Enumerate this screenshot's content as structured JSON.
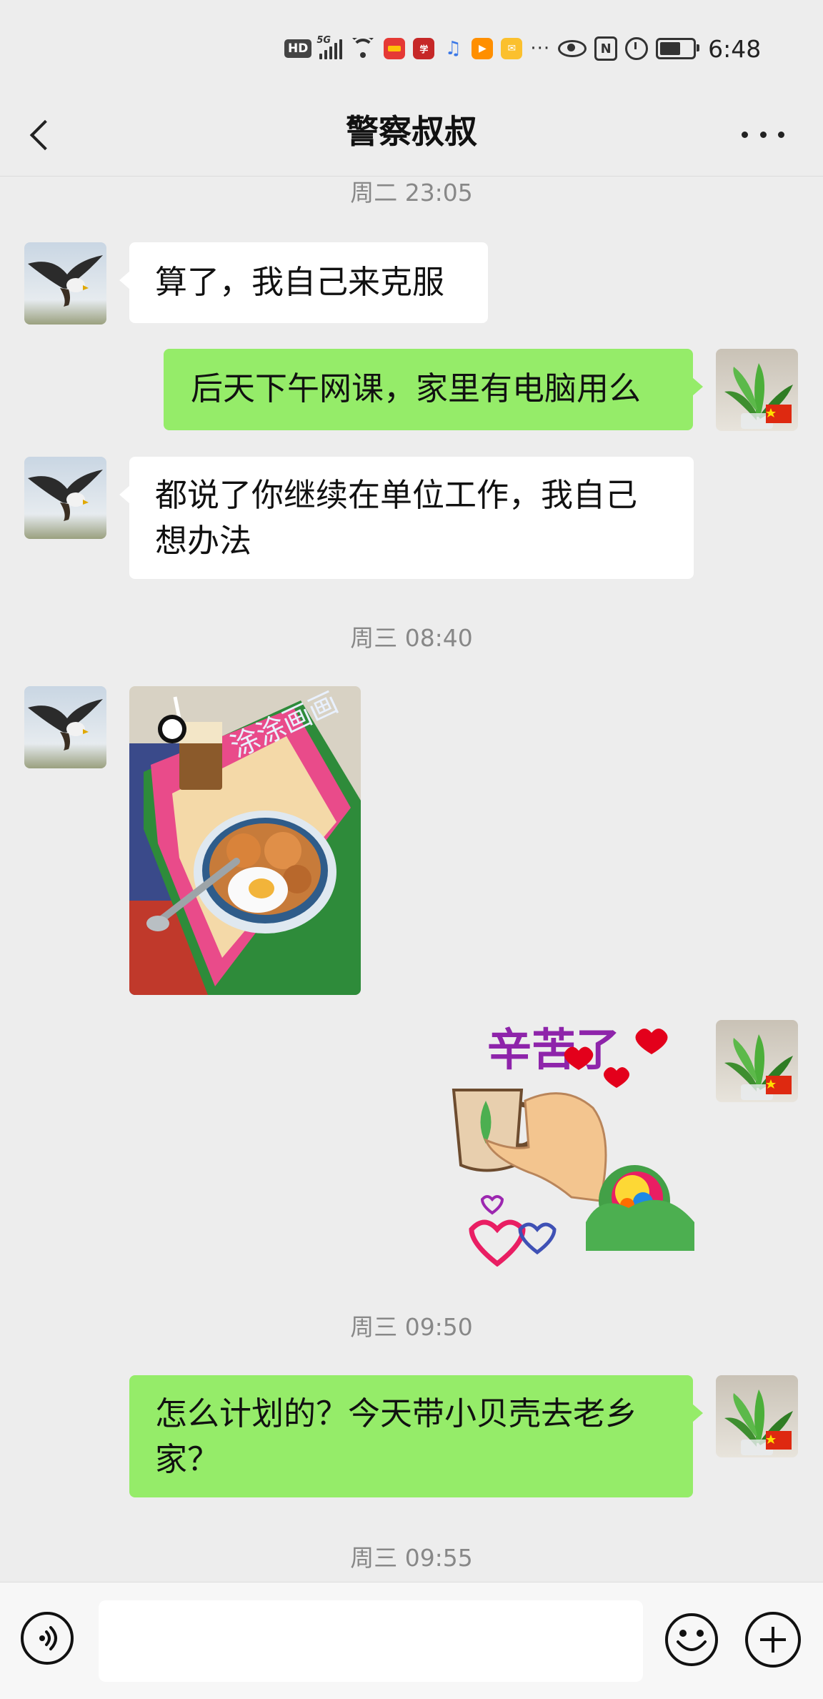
{
  "status_bar": {
    "hd": "HD",
    "network": "5G",
    "time": "6:48",
    "more": "···",
    "nfc": "N",
    "app_icons": [
      "gallery-app-icon",
      "xuexi-app-icon",
      "music-app-icon",
      "video-app-icon",
      "mail-app-icon"
    ]
  },
  "header": {
    "title": "警察叔叔",
    "back_icon": "chevron-left-icon",
    "more_icon": "more-dots-icon"
  },
  "messages": {
    "ts1": "周二 23:05",
    "m1": "算了，我自己来克服",
    "m2": "后天下午网课，家里有电脑用么",
    "m3_line1": "都说了你继续在单位工作，我自己",
    "m3_line2": "想办法",
    "ts2": "周三 08:40",
    "photo": "food-photo",
    "sticker_text": "辛苦了",
    "ts3": "周三 09:50",
    "m6_line1": "怎么计划的？今天带小贝壳去老乡",
    "m6_line2": "家？",
    "ts4": "周三 09:55"
  },
  "input_bar": {
    "voice_icon": "voice-icon",
    "emoji_icon": "emoji-icon",
    "plus_icon": "plus-icon"
  },
  "colors": {
    "background": "#ededed",
    "sent_bubble": "#95ec69",
    "received_bubble": "#ffffff"
  }
}
